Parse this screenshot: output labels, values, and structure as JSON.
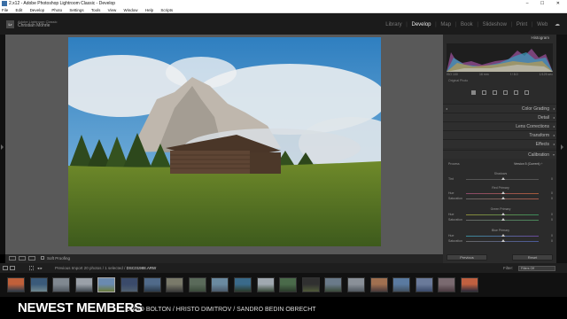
{
  "window": {
    "title": "2.x12 - Adobe Photoshop Lightroom Classic - Develop",
    "controls": "– ☐ ✕"
  },
  "menu": [
    "File",
    "Edit",
    "Develop",
    "Photo",
    "Settings",
    "Tools",
    "View",
    "Window",
    "Help",
    "Scripts"
  ],
  "identity": {
    "logo": "Lr",
    "product": "Adobe Lightroom Classic",
    "user": "Christian Möhrle"
  },
  "modules": [
    "Library",
    "Develop",
    "Map",
    "Book",
    "Slideshow",
    "Print",
    "Web"
  ],
  "active_module": "Develop",
  "right_panel": {
    "histogram_label": "Histogram",
    "hist_info": [
      "ISO 100",
      "16 mm",
      "f / 8.0",
      "1/125 sec"
    ],
    "original_photo": "Original Photo",
    "sections": [
      "Color Grading",
      "Detail",
      "Lens Corrections",
      "Transform",
      "Effects",
      "Calibration"
    ],
    "calibration": {
      "process_label": "Process",
      "process_value": "Version 5 (Current) ÷",
      "shadows": "Shadows",
      "tint": "Tint",
      "red_primary": "Red Primary",
      "green_primary": "Green Primary",
      "blue_primary": "Blue Primary",
      "hue": "Hue",
      "saturation": "Saturation",
      "zero": "0"
    },
    "previous_button": "Previous",
    "reset_button": "Reset"
  },
  "toolbar": {
    "soft_proofing": "Soft Proofing"
  },
  "filmstrip": {
    "nav": "◂ ▸",
    "source_prefix": "Previous Import",
    "source_count": "20 photos / 1 selected /",
    "filename": "DSC01988.ARW",
    "filter_label": "Filter:",
    "filter_value": "Filters Off",
    "thumbnail_count": 21,
    "selected_index": 4
  },
  "caption": {
    "title": "NEWEST MEMBERS",
    "names": "DAVID BOLTON  /  HRISTO DIMITROV  /  SANDRO BEDIN OBRECHT"
  },
  "colors": {
    "panel_bg": "#2b2b2b",
    "center_bg": "#595959",
    "identity_bg": "#1b1b1b",
    "sky": "#3b86c4",
    "grass": "#8a9a3a"
  }
}
